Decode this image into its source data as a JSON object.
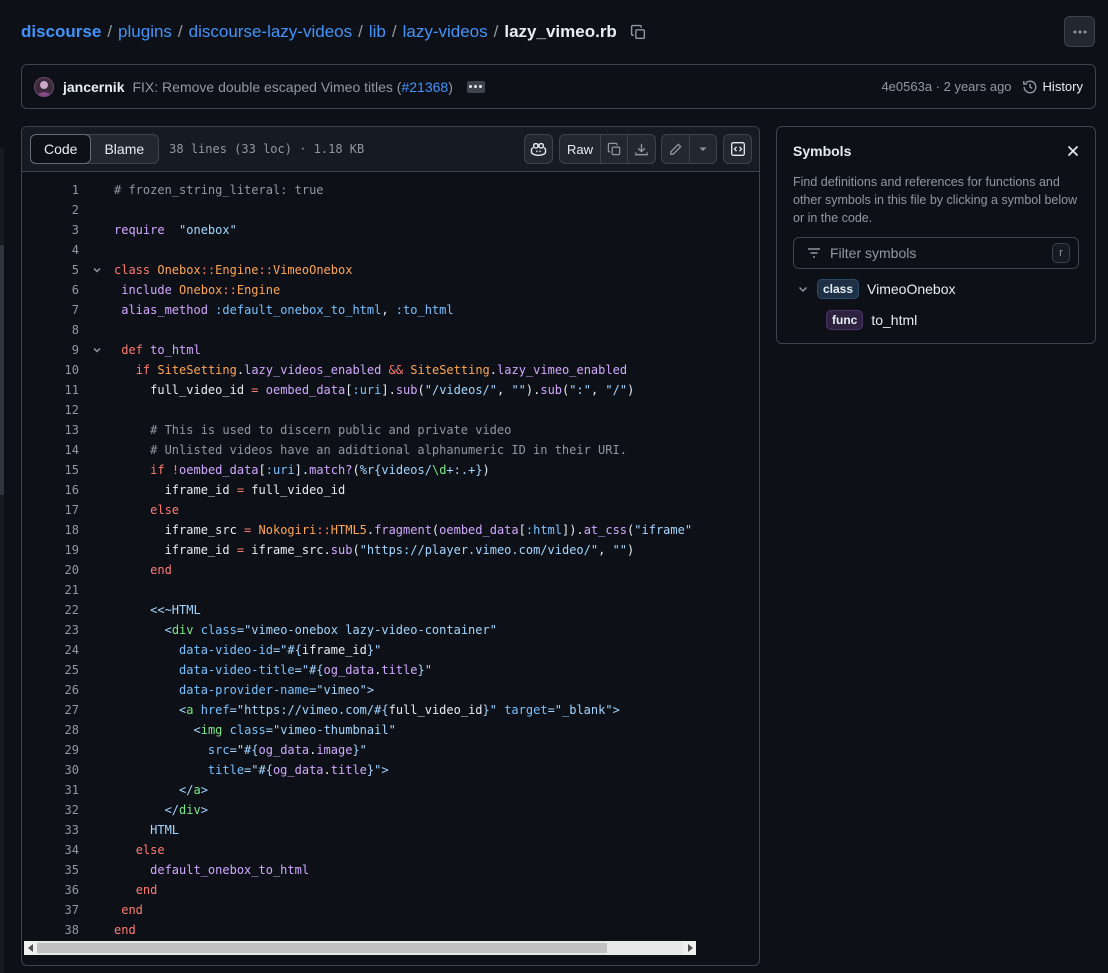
{
  "breadcrumb": {
    "repo": "discourse",
    "parts": [
      "plugins",
      "discourse-lazy-videos",
      "lib",
      "lazy-videos"
    ],
    "file": "lazy_vimeo.rb"
  },
  "commit": {
    "author": "jancernik",
    "message": "FIX: Remove double escaped Vimeo titles (",
    "pr": "#21368",
    "message_end": ")",
    "sha_time": "4e0563a · 2 years ago",
    "history_label": "History"
  },
  "code_header": {
    "tab_code": "Code",
    "tab_blame": "Blame",
    "file_meta": "38 lines (33 loc) · 1.18 KB",
    "raw_label": "Raw"
  },
  "code_lines": [
    {
      "n": "1",
      "fold": false
    },
    {
      "n": "2",
      "fold": false
    },
    {
      "n": "3",
      "fold": false
    },
    {
      "n": "4",
      "fold": false
    },
    {
      "n": "5",
      "fold": true
    },
    {
      "n": "6",
      "fold": false
    },
    {
      "n": "7",
      "fold": false
    },
    {
      "n": "8",
      "fold": false
    },
    {
      "n": "9",
      "fold": true
    },
    {
      "n": "10",
      "fold": false
    },
    {
      "n": "11",
      "fold": false
    },
    {
      "n": "12",
      "fold": false
    },
    {
      "n": "13",
      "fold": false
    },
    {
      "n": "14",
      "fold": false
    },
    {
      "n": "15",
      "fold": false
    },
    {
      "n": "16",
      "fold": false
    },
    {
      "n": "17",
      "fold": false
    },
    {
      "n": "18",
      "fold": false
    },
    {
      "n": "19",
      "fold": false
    },
    {
      "n": "20",
      "fold": false
    },
    {
      "n": "21",
      "fold": false
    },
    {
      "n": "22",
      "fold": false
    },
    {
      "n": "23",
      "fold": false
    },
    {
      "n": "24",
      "fold": false
    },
    {
      "n": "25",
      "fold": false
    },
    {
      "n": "26",
      "fold": false
    },
    {
      "n": "27",
      "fold": false
    },
    {
      "n": "28",
      "fold": false
    },
    {
      "n": "29",
      "fold": false
    },
    {
      "n": "30",
      "fold": false
    },
    {
      "n": "31",
      "fold": false
    },
    {
      "n": "32",
      "fold": false
    },
    {
      "n": "33",
      "fold": false
    },
    {
      "n": "34",
      "fold": false
    },
    {
      "n": "35",
      "fold": false
    },
    {
      "n": "36",
      "fold": false
    },
    {
      "n": "37",
      "fold": false
    },
    {
      "n": "38",
      "fold": false
    }
  ],
  "code_tokens": [
    [
      [
        "c",
        "# frozen_string_literal: true"
      ]
    ],
    [],
    [
      [
        "f",
        "require"
      ],
      [
        "",
        "  "
      ],
      [
        "s",
        "\"onebox\""
      ]
    ],
    [],
    [
      [
        "k",
        "class"
      ],
      [
        "",
        " "
      ],
      [
        "t",
        "Onebox"
      ],
      [
        "",
        ""
      ],
      [
        "k",
        "::"
      ],
      [
        "t",
        "Engine"
      ],
      [
        "k",
        "::"
      ],
      [
        "t",
        "VimeoOnebox"
      ]
    ],
    [
      [
        "",
        " "
      ],
      [
        "f",
        "include"
      ],
      [
        "",
        " "
      ],
      [
        "t",
        "Onebox"
      ],
      [
        "k",
        "::"
      ],
      [
        "t",
        "Engine"
      ]
    ],
    [
      [
        "",
        " "
      ],
      [
        "f",
        "alias_method"
      ],
      [
        "",
        " "
      ],
      [
        "v",
        ":default_onebox_to_html"
      ],
      [
        "",
        ", "
      ],
      [
        "v",
        ":to_html"
      ]
    ],
    [],
    [
      [
        "",
        " "
      ],
      [
        "k",
        "def"
      ],
      [
        "",
        " "
      ],
      [
        "f",
        "to_html"
      ]
    ],
    [
      [
        "",
        "   "
      ],
      [
        "k",
        "if"
      ],
      [
        "",
        " "
      ],
      [
        "t",
        "SiteSetting"
      ],
      [
        "",
        "."
      ],
      [
        "f",
        "lazy_videos_enabled"
      ],
      [
        "",
        " "
      ],
      [
        "k",
        "&&"
      ],
      [
        "",
        " "
      ],
      [
        "t",
        "SiteSetting"
      ],
      [
        "",
        "."
      ],
      [
        "f",
        "lazy_vimeo_enabled"
      ]
    ],
    [
      [
        "",
        "     full_video_id "
      ],
      [
        "k",
        "="
      ],
      [
        "",
        " "
      ],
      [
        "f",
        "oembed_data"
      ],
      [
        "",
        "["
      ],
      [
        "v",
        ":uri"
      ],
      [
        "",
        "]."
      ],
      [
        "f",
        "sub"
      ],
      [
        "",
        "("
      ],
      [
        "s",
        "\"/videos/\""
      ],
      [
        "",
        ", "
      ],
      [
        "s",
        "\"\""
      ],
      [
        "",
        ")."
      ],
      [
        "f",
        "sub"
      ],
      [
        "",
        "("
      ],
      [
        "s",
        "\":\""
      ],
      [
        "",
        ", "
      ],
      [
        "s",
        "\"/\""
      ],
      [
        "",
        ")"
      ]
    ],
    [],
    [
      [
        "",
        "     "
      ],
      [
        "c",
        "# This is used to discern public and private video"
      ]
    ],
    [
      [
        "",
        "     "
      ],
      [
        "c",
        "# Unlisted videos have an adidtional alphanumeric ID in their URI."
      ]
    ],
    [
      [
        "",
        "     "
      ],
      [
        "k",
        "if"
      ],
      [
        "",
        " "
      ],
      [
        "k",
        "!"
      ],
      [
        "f",
        "oembed_data"
      ],
      [
        "",
        "["
      ],
      [
        "v",
        ":uri"
      ],
      [
        "",
        "]."
      ],
      [
        "f",
        "match?"
      ],
      [
        "",
        "("
      ],
      [
        "s",
        "%r{videos/"
      ],
      [
        "g",
        "\\d"
      ],
      [
        "s",
        "+:.+}"
      ],
      [
        "",
        ")"
      ]
    ],
    [
      [
        "",
        "       iframe_id "
      ],
      [
        "k",
        "="
      ],
      [
        "",
        " full_video_id"
      ]
    ],
    [
      [
        "",
        "     "
      ],
      [
        "k",
        "else"
      ]
    ],
    [
      [
        "",
        "       iframe_src "
      ],
      [
        "k",
        "="
      ],
      [
        "",
        " "
      ],
      [
        "t",
        "Nokogiri"
      ],
      [
        "k",
        "::"
      ],
      [
        "t",
        "HTML5"
      ],
      [
        "",
        "."
      ],
      [
        "f",
        "fragment"
      ],
      [
        "",
        "("
      ],
      [
        "f",
        "oembed_data"
      ],
      [
        "",
        "["
      ],
      [
        "v",
        ":html"
      ],
      [
        "",
        "])."
      ],
      [
        "f",
        "at_css"
      ],
      [
        "",
        "("
      ],
      [
        "s",
        "\"iframe\""
      ]
    ],
    [
      [
        "",
        "       iframe_id "
      ],
      [
        "k",
        "="
      ],
      [
        "",
        " iframe_src."
      ],
      [
        "f",
        "sub"
      ],
      [
        "",
        "("
      ],
      [
        "s",
        "\"https://player.vimeo.com/video/\""
      ],
      [
        "",
        ", "
      ],
      [
        "s",
        "\"\""
      ],
      [
        "",
        ")"
      ]
    ],
    [
      [
        "",
        "     "
      ],
      [
        "k",
        "end"
      ]
    ],
    [],
    [
      [
        "",
        "     "
      ],
      [
        "s",
        "<<~HTML"
      ]
    ],
    [
      [
        "",
        "       "
      ],
      [
        "s",
        "<"
      ],
      [
        "g",
        "div"
      ],
      [
        "",
        " "
      ],
      [
        "v",
        "class"
      ],
      [
        "s",
        "=\"vimeo-onebox lazy-video-container\""
      ]
    ],
    [
      [
        "",
        "         "
      ],
      [
        "v",
        "data-video-id"
      ],
      [
        "s",
        "=\"#{"
      ],
      [
        "",
        "iframe_id"
      ],
      [
        "s",
        "}\""
      ]
    ],
    [
      [
        "",
        "         "
      ],
      [
        "v",
        "data-video-title"
      ],
      [
        "s",
        "=\"#{"
      ],
      [
        "f",
        "og_data"
      ],
      [
        "",
        "."
      ],
      [
        "f",
        "title"
      ],
      [
        "s",
        "}\""
      ]
    ],
    [
      [
        "",
        "         "
      ],
      [
        "v",
        "data-provider-name"
      ],
      [
        "s",
        "=\"vimeo\">"
      ]
    ],
    [
      [
        "",
        "         "
      ],
      [
        "s",
        "<"
      ],
      [
        "g",
        "a"
      ],
      [
        "",
        " "
      ],
      [
        "v",
        "href"
      ],
      [
        "s",
        "=\"https://vimeo.com/#{"
      ],
      [
        "",
        "full_video_id"
      ],
      [
        "s",
        "}\""
      ],
      [
        "",
        " "
      ],
      [
        "v",
        "target"
      ],
      [
        "s",
        "=\"_blank\">"
      ]
    ],
    [
      [
        "",
        "           "
      ],
      [
        "s",
        "<"
      ],
      [
        "g",
        "img"
      ],
      [
        "",
        " "
      ],
      [
        "v",
        "class"
      ],
      [
        "s",
        "=\"vimeo-thumbnail\""
      ]
    ],
    [
      [
        "",
        "             "
      ],
      [
        "v",
        "src"
      ],
      [
        "s",
        "=\"#{"
      ],
      [
        "f",
        "og_data"
      ],
      [
        "",
        "."
      ],
      [
        "f",
        "image"
      ],
      [
        "s",
        "}\""
      ]
    ],
    [
      [
        "",
        "             "
      ],
      [
        "v",
        "title"
      ],
      [
        "s",
        "=\"#{"
      ],
      [
        "f",
        "og_data"
      ],
      [
        "",
        "."
      ],
      [
        "f",
        "title"
      ],
      [
        "s",
        "}\">"
      ]
    ],
    [
      [
        "",
        "         "
      ],
      [
        "s",
        "</"
      ],
      [
        "g",
        "a"
      ],
      [
        "s",
        ">"
      ]
    ],
    [
      [
        "",
        "       "
      ],
      [
        "s",
        "</"
      ],
      [
        "g",
        "div"
      ],
      [
        "s",
        ">"
      ]
    ],
    [
      [
        "",
        "     "
      ],
      [
        "s",
        "HTML"
      ]
    ],
    [
      [
        "",
        "   "
      ],
      [
        "k",
        "else"
      ]
    ],
    [
      [
        "",
        "     "
      ],
      [
        "f",
        "default_onebox_to_html"
      ]
    ],
    [
      [
        "",
        "   "
      ],
      [
        "k",
        "end"
      ]
    ],
    [
      [
        "",
        " "
      ],
      [
        "k",
        "end"
      ]
    ],
    [
      [
        "k",
        "end"
      ]
    ]
  ],
  "symbols": {
    "title": "Symbols",
    "description": "Find definitions and references for functions and other symbols in this file by clicking a symbol below or in the code.",
    "filter_placeholder": "Filter symbols",
    "filter_shortcut": "r",
    "items": [
      {
        "kind": "class",
        "name": "VimeoOnebox"
      },
      {
        "kind": "func",
        "name": "to_html"
      }
    ]
  }
}
